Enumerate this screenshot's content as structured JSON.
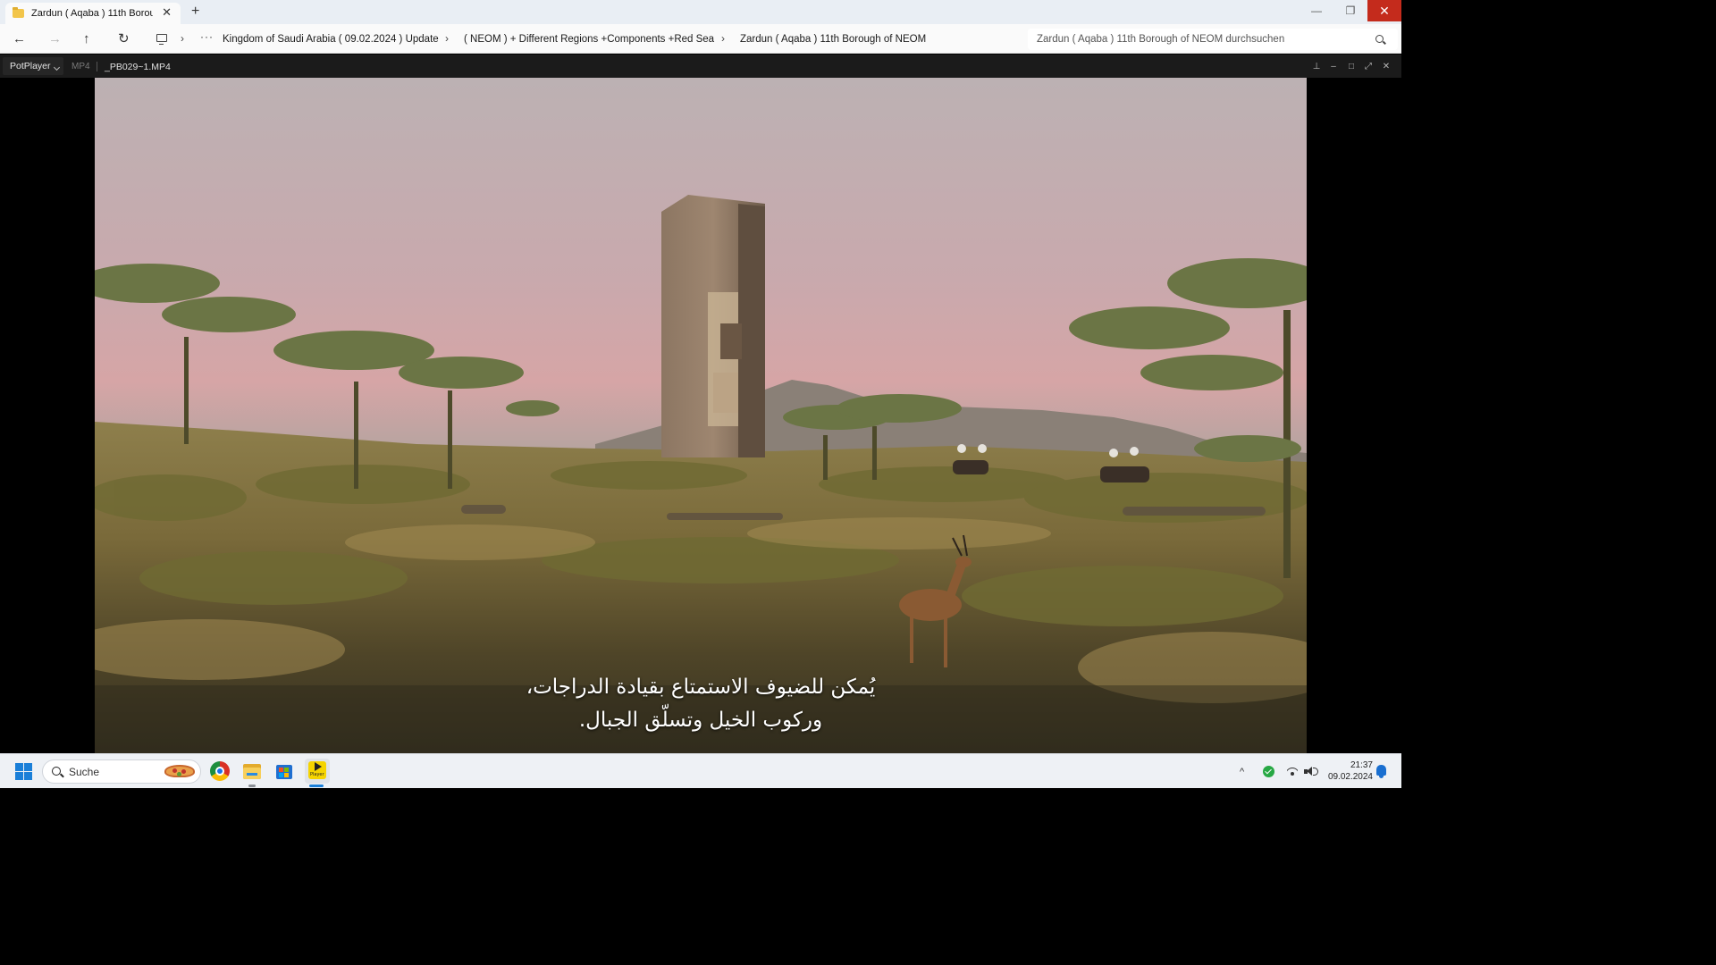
{
  "explorer": {
    "tab_title": "Zardun ( Aqaba ) 11th Borough of NEOM",
    "tab_close": "✕",
    "new_tab": "+",
    "window_controls": {
      "minimize": "—",
      "maximize": "❐",
      "close": "✕"
    },
    "nav": {
      "back": "←",
      "forward": "→",
      "up": "↑",
      "refresh": "↻"
    },
    "breadcrumb": {
      "more": "···",
      "separator": "›",
      "items": [
        "Kingdom of Saudi Arabia ( 09.02.2024 ) Update",
        "( NEOM ) + Different Regions +Components +Red Sea",
        "Zardun ( Aqaba ) 11th Borough of NEOM"
      ]
    },
    "search_placeholder": "Zardun ( Aqaba ) 11th Borough of NEOM durchsuchen"
  },
  "player": {
    "brand": "PotPlayer",
    "format": "MP4",
    "filename": "_PB029~1.MP4",
    "controls": {
      "pin": "⊥",
      "minimize": "–",
      "maximize": "□",
      "fullscreen": "⤢",
      "close": "✕"
    },
    "subtitle_lines": [
      "يُمكن للضيوف الاستمتاع بقيادة الدراجات،",
      "وركوب الخيل وتسلّق الجبال."
    ]
  },
  "taskbar": {
    "search_label": "Suche",
    "apps": [
      "chrome-icon",
      "file-explorer-icon",
      "microsoft-store-icon",
      "potplayer-icon"
    ],
    "pinned_app_label": "Player",
    "tray_chevron": "^",
    "clock": {
      "time": "21:37",
      "date": "09.02.2024"
    }
  },
  "colors": {
    "accent": "#1a7fd8",
    "close_red": "#c42b1c",
    "player_bg": "#1b1b1b",
    "potplayer_yellow": "#f5d400"
  }
}
